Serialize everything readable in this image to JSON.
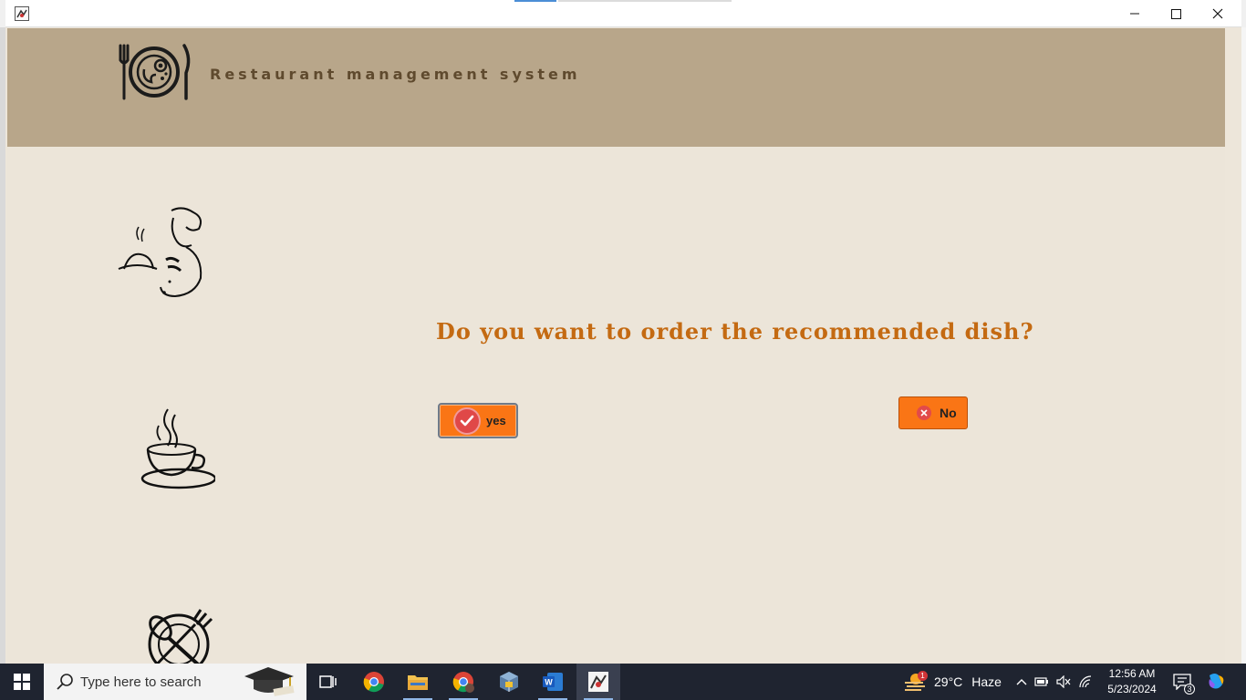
{
  "window": {
    "controls": {
      "minimize": "minimize",
      "maximize": "maximize",
      "close": "close"
    }
  },
  "header": {
    "title": "Restaurant management system"
  },
  "dialog": {
    "question": "Do you want to order the recommended dish?",
    "yes_label": "yes",
    "no_label": "No"
  },
  "taskbar": {
    "search_placeholder": "Type here to search",
    "apps": [
      "task-view",
      "chrome",
      "file-explorer",
      "chrome-profile",
      "virtualbox",
      "word",
      "java-app"
    ],
    "weather": {
      "temp": "29°C",
      "condition": "Haze",
      "badge": "1"
    },
    "time": "12:56 AM",
    "date": "5/23/2024",
    "notifications": "3"
  },
  "colors": {
    "header_bg": "#b8a68a",
    "content_bg": "#ece5d9",
    "title_color": "#5f4a2e",
    "question_color": "#c46a12",
    "button_orange": "#fa7515"
  }
}
